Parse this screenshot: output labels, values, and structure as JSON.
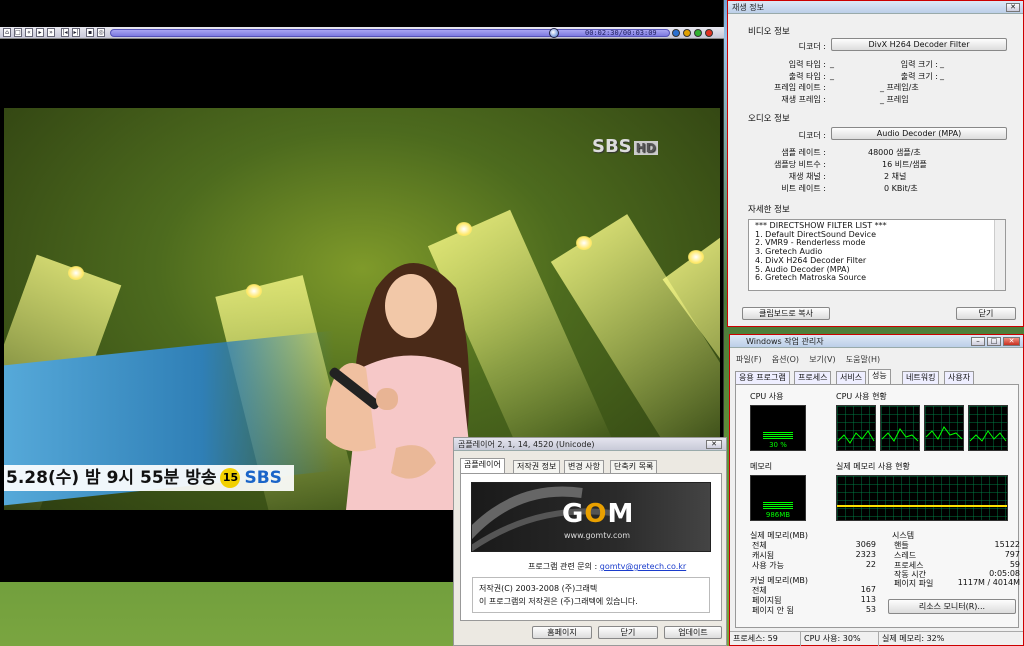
{
  "player": {
    "time": "00:02:30/00:03:09",
    "toolbar_icons": [
      "home-icon",
      "fullscreen-icon",
      "rewind-icon",
      "play-icon",
      "forward-icon",
      "prev-icon",
      "next-icon",
      "skip-icon",
      "settings-icon"
    ],
    "seek_progress": 0.7937
  },
  "video": {
    "broadcaster_logo": "SBS",
    "hd_badge": "HD",
    "ticker_text": "5.28(수) 밤 9시 55분 방송",
    "age_rating": "15",
    "ticker_logo": "SBS"
  },
  "playback_info": {
    "title": "재생 정보",
    "video_section": "비디오 정보",
    "decoder_label": "디코더 :",
    "video_decoder": "DivX H264 Decoder Filter",
    "input_type_label": "입력 타입 :",
    "input_type_value": "_",
    "input_size_label": "입력 크기 :",
    "input_size_value": "_",
    "output_type_label": "출력 타입 :",
    "output_type_value": "_",
    "output_size_label": "출력 크기 :",
    "output_size_value": "_",
    "frame_rate_label": "프레임 레이트 :",
    "frame_rate_value": "_ 프레임/초",
    "play_frames_label": "재생 프레임 :",
    "play_frames_value": "_ 프레임",
    "audio_section": "오디오 정보",
    "audio_decoder_label": "디코더 :",
    "audio_decoder": "Audio Decoder (MPA)",
    "sample_rate_label": "샘플 레이트 :",
    "sample_rate_value": "48000 샘플/초",
    "bits_label": "샘플당 비트수 :",
    "bits_value": "16 비트/샘플",
    "channels_label": "재생 채널 :",
    "channels_value": "2 채널",
    "bitrate_label": "비트 레이트 :",
    "bitrate_value": "0 KBit/초",
    "detail_section": "자세한 정보",
    "filter_list": [
      "*** DIRECTSHOW FILTER LIST ***",
      "1. Default DirectSound Device",
      "2. VMR9 - Renderless mode",
      "3. Gretech Audio",
      "4. DivX H264 Decoder Filter",
      "5. Audio Decoder (MPA)",
      "6. Gretech Matroska Source"
    ],
    "copy_button": "클립보드로 복사",
    "close_button": "닫기"
  },
  "task_manager": {
    "title": "Windows 작업 관리자",
    "menu": [
      "파일(F)",
      "옵션(O)",
      "보기(V)",
      "도움말(H)"
    ],
    "tabs": [
      "응용 프로그램",
      "프로세스",
      "서비스",
      "성능",
      "네트워킹",
      "사용자"
    ],
    "active_tab": "성능",
    "cpu_usage_label": "CPU 사용",
    "cpu_usage_value": "30 %",
    "cpu_usage_fraction": 0.3,
    "cpu_history_label": "CPU 사용 현황",
    "memory_label": "메모리",
    "memory_value": "986MB",
    "memory_fraction": 0.32,
    "memory_history_label": "실제 메모리 사용 현황",
    "physical_memory": {
      "label": "실제 메모리(MB)",
      "rows": [
        [
          "전체",
          "3069"
        ],
        [
          "캐시됨",
          "2323"
        ],
        [
          "사용 가능",
          "22"
        ]
      ]
    },
    "kernel_memory": {
      "label": "커널 메모리(MB)",
      "rows": [
        [
          "전체",
          "167"
        ],
        [
          "페이지됨",
          "113"
        ],
        [
          "페이지 안 됨",
          "53"
        ]
      ]
    },
    "system": {
      "label": "시스템",
      "rows": [
        [
          "핸들",
          "15122"
        ],
        [
          "스레드",
          "797"
        ],
        [
          "프로세스",
          "59"
        ],
        [
          "작동 시간",
          "0:05:08"
        ],
        [
          "페이지 파일",
          "1117M / 4014M"
        ]
      ]
    },
    "resource_monitor_button": "리소스 모니터(R)...",
    "status": {
      "processes": "프로세스: 59",
      "cpu": "CPU 사용: 30%",
      "memory": "실제 메모리: 32%"
    }
  },
  "about": {
    "title": "곰플레이어 2, 1, 14, 4520 (Unicode)",
    "tabs": [
      "곰플레이어",
      "저작권 정보",
      "변경 사항",
      "단축키 목록"
    ],
    "logo_text": "G",
    "logo_o": "O",
    "logo_m": "M",
    "website": "www.gomtv.com",
    "contact_label": "프로그램 관련 문의 :",
    "contact_email": "gomtv@gretech.co.kr",
    "copyright_1": "저작권(C) 2003-2008 (주)그래텍",
    "copyright_2": "이 프로그램의 저작권은 (주)그래텍에 있습니다.",
    "homepage_button": "홈페이지",
    "close_button": "닫기",
    "update_button": "업데이트"
  }
}
